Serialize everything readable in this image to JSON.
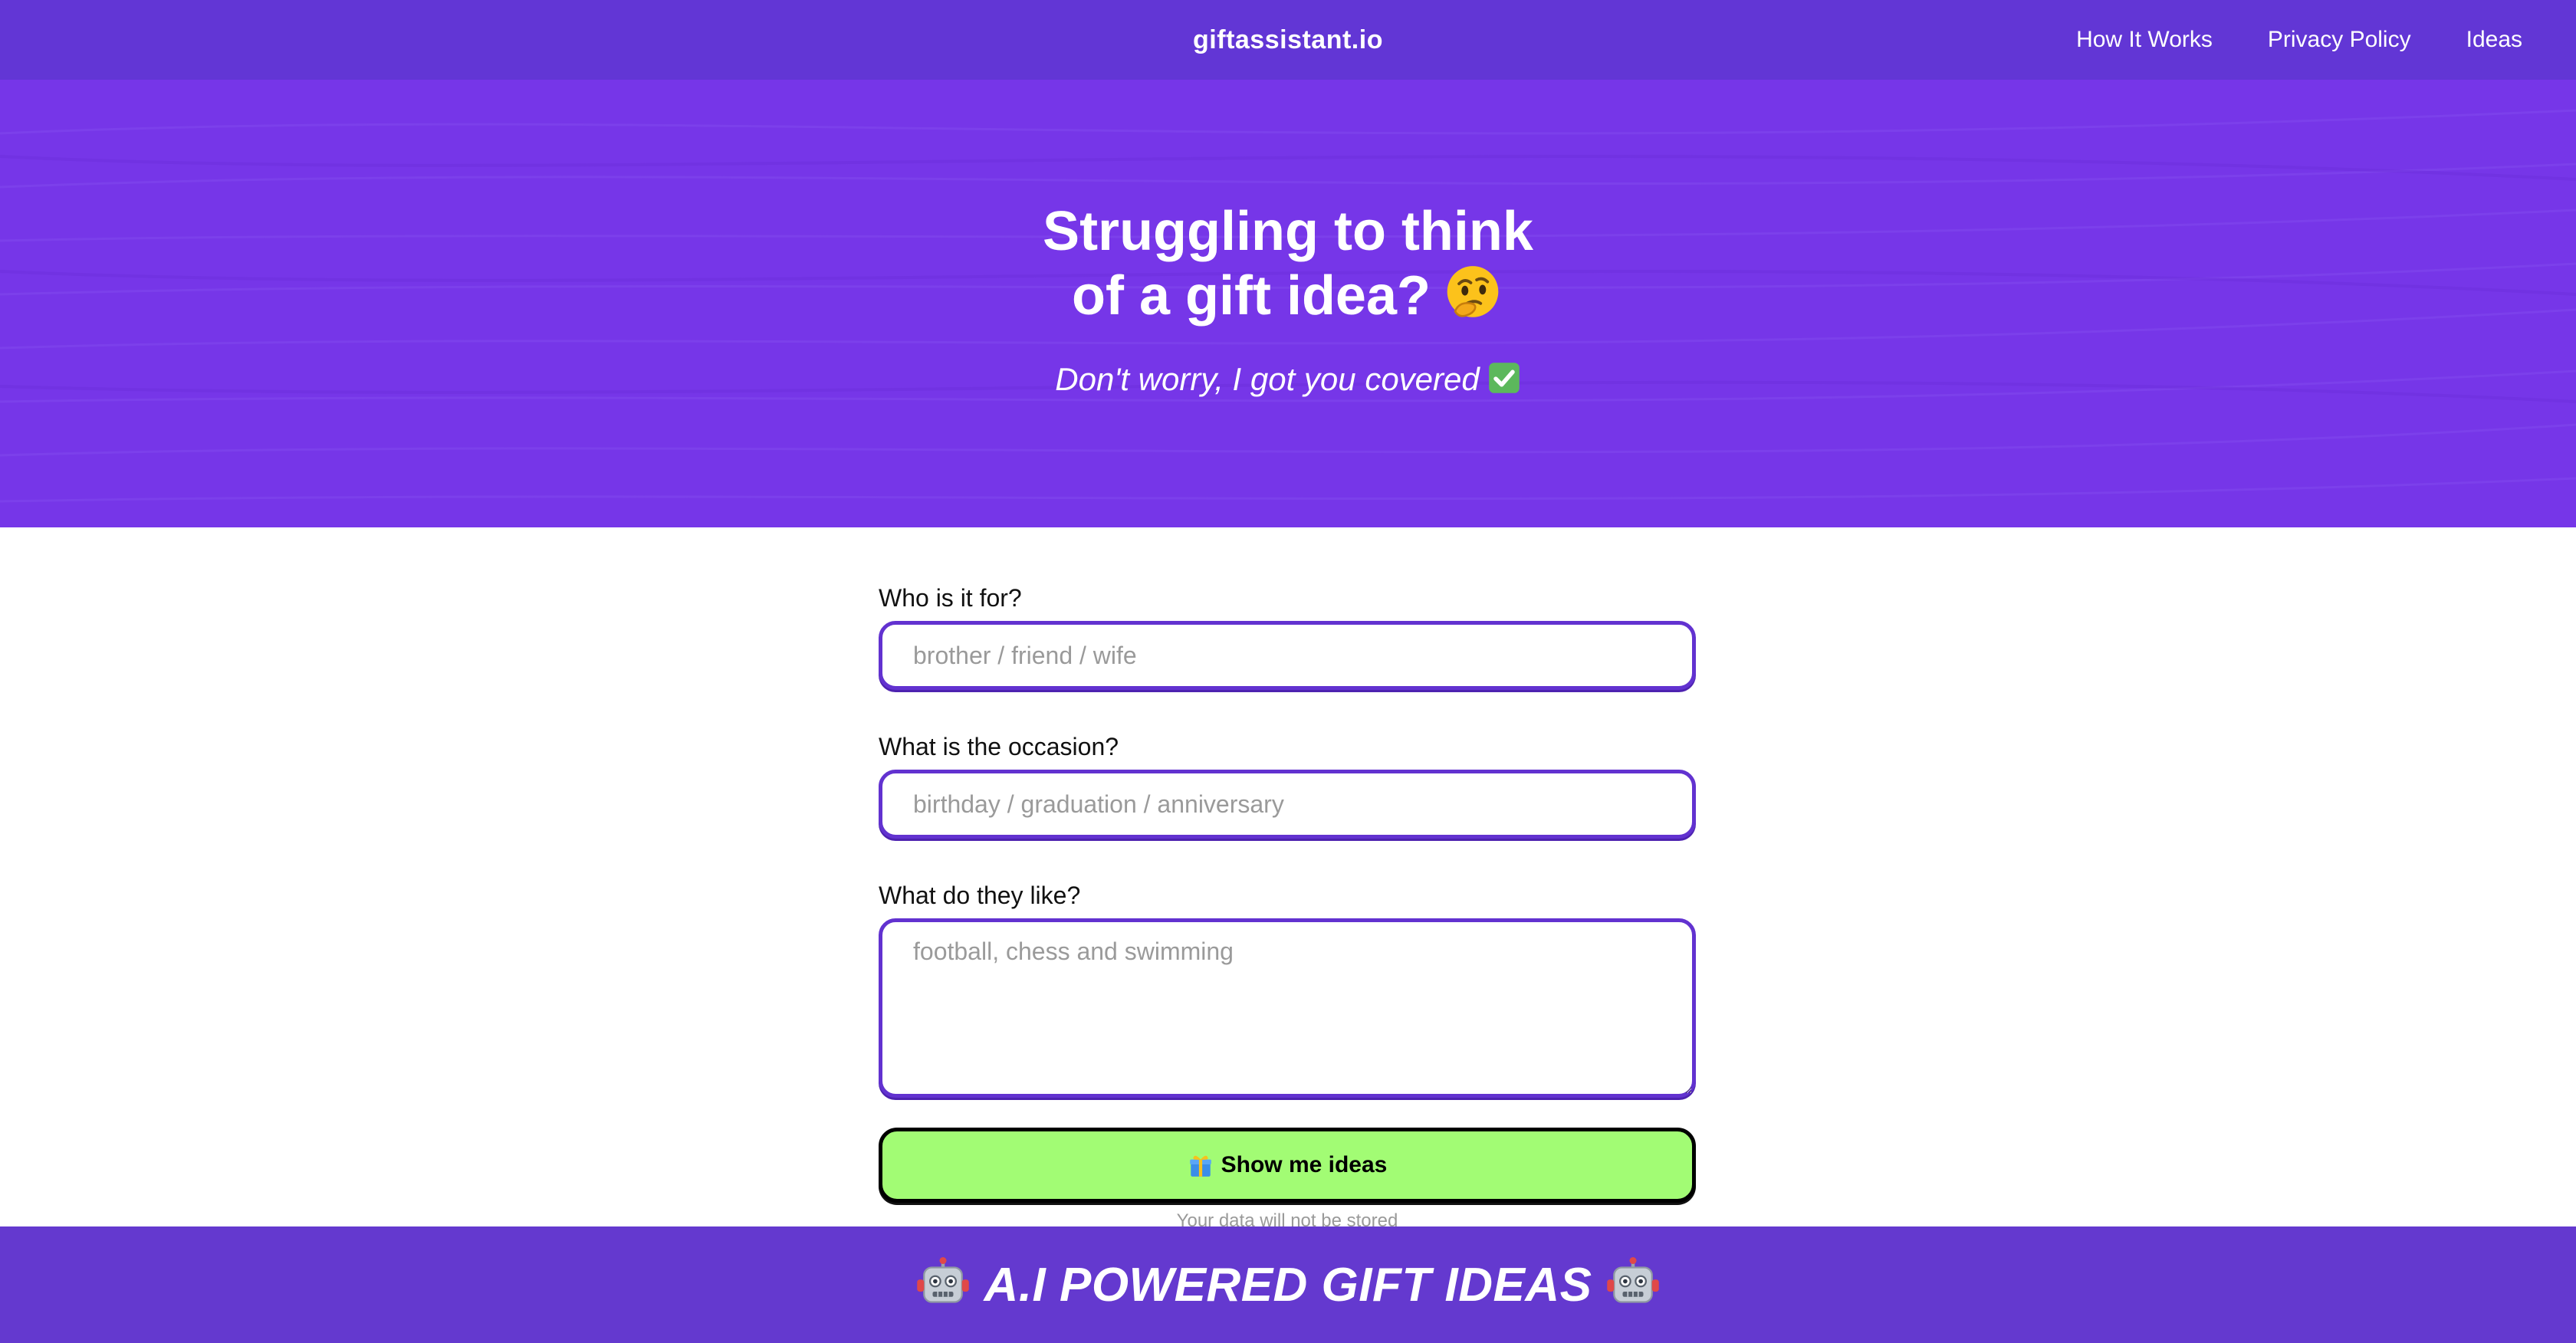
{
  "nav": {
    "brand": "giftassistant.io",
    "links": [
      "How It Works",
      "Privacy Policy",
      "Ideas"
    ]
  },
  "hero": {
    "title_line1": "Struggling to think",
    "title_line2": "of a gift idea?",
    "title_icon": "thinking-face-icon",
    "subtitle": "Don't worry, I got you covered",
    "subtitle_icon": "check-mark-icon"
  },
  "form": {
    "who": {
      "label": "Who is it for?",
      "placeholder": "brother / friend / wife",
      "value": ""
    },
    "occasion": {
      "label": "What is the occasion?",
      "placeholder": "birthday / graduation / anniversary",
      "value": ""
    },
    "likes": {
      "label": "What do they like?",
      "placeholder": "football, chess and swimming",
      "value": ""
    },
    "submit_label": "Show me ideas",
    "submit_icon": "gift-icon",
    "note": "Your data will not be stored"
  },
  "banner": {
    "text": "A.I POWERED GIFT IDEAS",
    "icon": "robot-icon"
  },
  "colors": {
    "nav_bg": "#6236d5",
    "hero_bg": "#7636e8",
    "input_border": "#6232d0",
    "button_bg": "#a2fc74",
    "banner_bg": "#6439cf"
  }
}
